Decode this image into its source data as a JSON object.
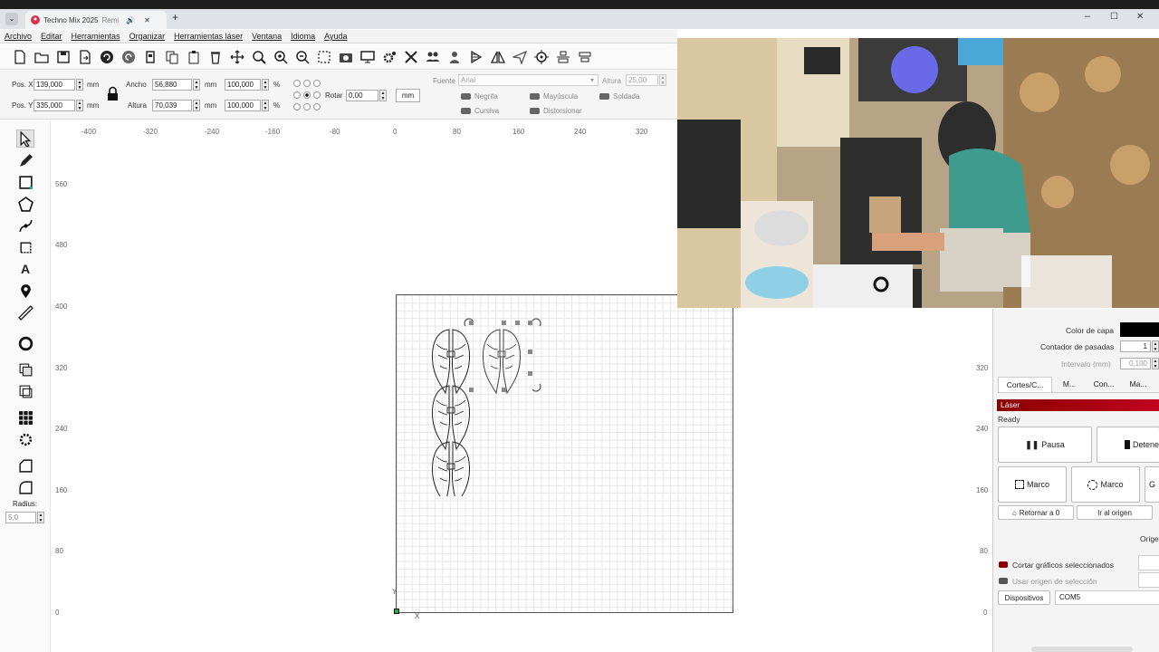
{
  "browser": {
    "tab_title": "Techno Mix 2025",
    "tab_suffix": "Remi",
    "new_tab": "+",
    "close_tab": "✕",
    "win_min": "–",
    "win_max": "☐",
    "win_close": "✕"
  },
  "menu": [
    "Archivo",
    "Editar",
    "Herramientas",
    "Organizar",
    "Herramientas láser",
    "Ventana",
    "Idioma",
    "Ayuda"
  ],
  "props": {
    "posx_label": "Pos. X",
    "posx": "139,000",
    "posy_label": "Pos. Y",
    "posy": "335,000",
    "mm": "mm",
    "ancho_label": "Ancho",
    "ancho": "56,880",
    "altura_label": "Altura",
    "altura": "70,039",
    "pct1": "100,000",
    "pct2": "100,000",
    "pct": "%",
    "rotar_label": "Rotar",
    "rotar": "0,00",
    "mm_button": "mm",
    "fuente_label": "Fuente",
    "fuente": "Arial",
    "font_altura_label": "Altura",
    "font_altura": "25,00",
    "negrita": "Negrita",
    "mayuscula": "Mayúscula",
    "soldada": "Soldada",
    "cursiva": "Cursiva",
    "distorsionar": "Distorsionar"
  },
  "ruler_h": [
    "-400",
    "-320",
    "-240",
    "-160",
    "-80",
    "0",
    "80",
    "160",
    "240",
    "320"
  ],
  "ruler_v": [
    "560",
    "480",
    "400",
    "320",
    "240",
    "160",
    "80",
    "0"
  ],
  "ruler_v_right": [
    "320",
    "240",
    "160",
    "80",
    "0"
  ],
  "axis": {
    "x": "X",
    "y": "Y"
  },
  "left": {
    "radius_label": "Radius:",
    "radius": "5,0"
  },
  "right": {
    "color_capa": "Color de capa",
    "contador": "Contador de pasadas",
    "contador_val": "1",
    "intervalo": "Intervalo (mm)",
    "intervalo_val": "0,100",
    "tabs": [
      "Cortes/C...",
      "M...",
      "Con...",
      "Ma..."
    ],
    "laser_header": "Láser",
    "status": "Ready",
    "pausa": "Pausa",
    "detener": "Detene",
    "marco1": "Marco",
    "marco2": "Marco",
    "g": "G",
    "retornar": "Retornar a 0",
    "ir_origen": "Ir al origen",
    "origen": "Orige",
    "cortar": "Cortar gráficos seleccionados",
    "usar_origen": "Usar origen de selección",
    "dispositivos": "Dispositivos",
    "com": "COM5"
  },
  "colors": {
    "accent": "#8b0000",
    "layer_color": "#000000"
  }
}
